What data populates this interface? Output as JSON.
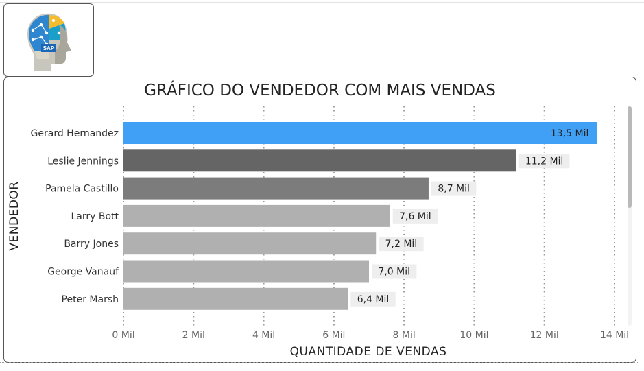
{
  "colors": {
    "highlight": "#3fa0f5",
    "second": "#656565",
    "third": "#7c7c7c",
    "rest": "#b0b0b0",
    "label_bg": "#eeeeee",
    "grid": "#9a9a9a"
  },
  "logo": {
    "text": "SAP"
  },
  "chart_data": {
    "type": "bar",
    "orientation": "horizontal",
    "title": "GRÁFICO DO VENDEDOR COM MAIS VENDAS",
    "xlabel": "QUANTIDADE DE VENDAS",
    "ylabel": "VENDEDOR",
    "categories": [
      "Gerard Hernandez",
      "Leslie Jennings",
      "Pamela Castillo",
      "Larry Bott",
      "Barry Jones",
      "George Vanauf",
      "Peter Marsh"
    ],
    "values": [
      13.5,
      11.2,
      8.7,
      7.6,
      7.2,
      7.0,
      6.4
    ],
    "value_labels": [
      "13,5 Mil",
      "11,2 Mil",
      "8,7 Mil",
      "7,6 Mil",
      "7,2 Mil",
      "7,0 Mil",
      "6,4 Mil"
    ],
    "xlim": [
      0,
      14
    ],
    "xticks": [
      0,
      2,
      4,
      6,
      8,
      10,
      12,
      14
    ],
    "xtick_labels": [
      "0 Mil",
      "2 Mil",
      "4 Mil",
      "6 Mil",
      "8 Mil",
      "10 Mil",
      "12 Mil",
      "14 Mil"
    ],
    "unit": "Mil",
    "grid": "vertical dotted",
    "legend": "none"
  }
}
